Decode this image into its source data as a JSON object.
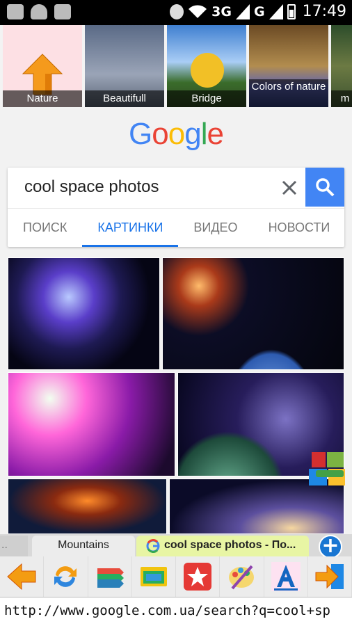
{
  "status_bar": {
    "network_1": "3G",
    "network_2": "G",
    "time": "17:49"
  },
  "themes": [
    {
      "label": "Nature"
    },
    {
      "label": "Beautifull"
    },
    {
      "label": "Bridge"
    },
    {
      "label": "Colors of nature"
    },
    {
      "label": "m"
    }
  ],
  "search": {
    "query": "cool space photos",
    "tabs": [
      {
        "label": "ПОИСК",
        "active": false
      },
      {
        "label": "КАРТИНКИ",
        "active": true
      },
      {
        "label": "ВИДЕО",
        "active": false
      },
      {
        "label": "НОВОСТИ",
        "active": false
      }
    ]
  },
  "browser_tabs": {
    "previous": "..",
    "mountains": "Mountains",
    "current": "cool space photos - По..."
  },
  "url": "http://www.google.com.ua/search?q=cool+sp",
  "colors": {
    "google_blue": "#4285F4",
    "google_red": "#EA4335",
    "google_yellow": "#FBBC05",
    "google_green": "#34A853",
    "active_tab": "#1A73E8",
    "current_tab_bg": "#E8F5A4"
  },
  "toolbar_icons": [
    "back-arrow-icon",
    "refresh-icon",
    "bookmarks-icon",
    "folder-tabs-icon",
    "favorites-star-icon",
    "themes-palette-icon",
    "font-size-icon",
    "forward-exit-icon"
  ]
}
